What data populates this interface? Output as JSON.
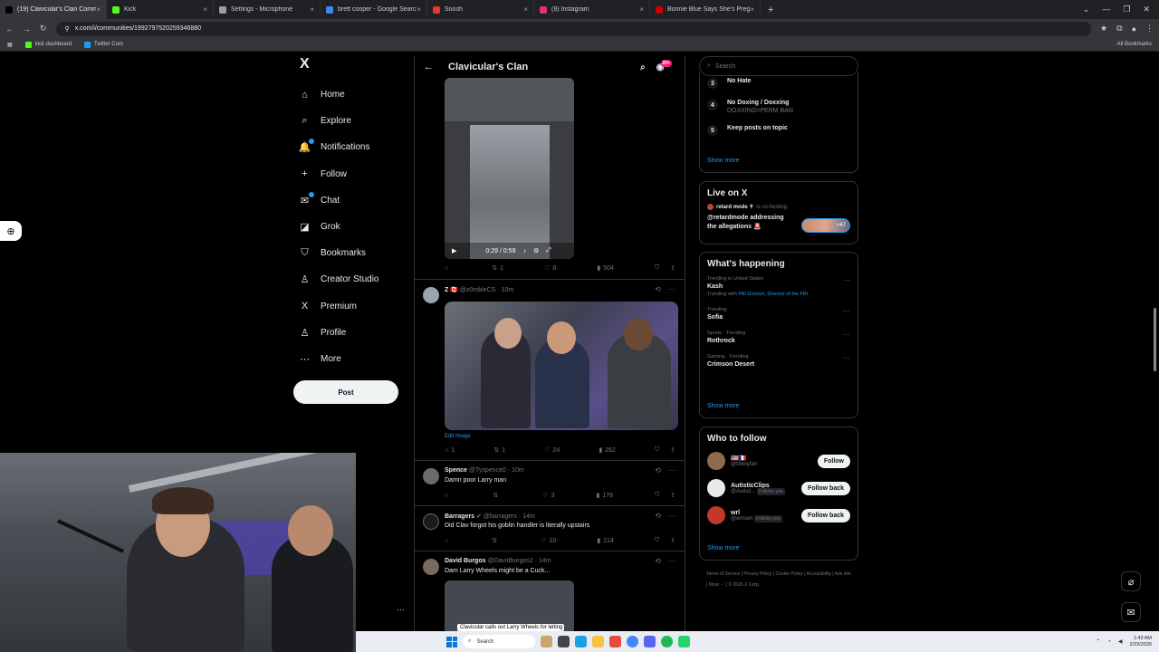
{
  "browser": {
    "tabs": [
      {
        "label": "(19) Clavicular's Clan Comm",
        "color": "#000000",
        "active": true
      },
      {
        "label": "Kick",
        "color": "#53fc18"
      },
      {
        "label": "Settings - Microphone",
        "color": "#9aa0a6"
      },
      {
        "label": "brett cooper - Google Search",
        "color": "#4285f4"
      },
      {
        "label": "Soosh",
        "color": "#e53935"
      },
      {
        "label": "(9) Instagram",
        "color": "#e1306c"
      },
      {
        "label": "Bonnie Blue Says She's Pregnan",
        "color": "#cc0000"
      }
    ],
    "url": "x.com/i/communities/1992797520259346880",
    "bookmarks": [
      {
        "label": "kick dashboard",
        "color": "#53fc18"
      },
      {
        "label": "Twitter Com",
        "color": "#1d9bf0"
      }
    ],
    "all_bookmarks": "All Bookmarks"
  },
  "nav": {
    "logo": "X",
    "items": [
      {
        "label": "Home",
        "icon": "⌂"
      },
      {
        "label": "Explore",
        "icon": "⌕"
      },
      {
        "label": "Notifications",
        "icon": "🔔"
      },
      {
        "label": "Follow",
        "icon": "+"
      },
      {
        "label": "Chat",
        "icon": "✉"
      },
      {
        "label": "Grok",
        "icon": "◪"
      },
      {
        "label": "Bookmarks",
        "icon": "⛉"
      },
      {
        "label": "Creator Studio",
        "icon": "♙"
      },
      {
        "label": "Premium",
        "icon": "X"
      },
      {
        "label": "Profile",
        "icon": "♙"
      },
      {
        "label": "More",
        "icon": "⋯"
      }
    ],
    "post_button": "Post"
  },
  "timeline": {
    "title": "Clavicular's Clan",
    "badge": "20+",
    "video": {
      "time": "0:29 / 0:59"
    },
    "video_actions": {
      "replies": "",
      "reposts": "1",
      "likes": "8",
      "views": "504"
    },
    "posts": [
      {
        "name": "Z",
        "flags": "🇨🇦",
        "handle": "@z0mbleCS",
        "time": "10m",
        "text": "",
        "edit_image": "Edit Image",
        "replies": "1",
        "reposts": "1",
        "likes": "24",
        "views": "262"
      },
      {
        "name": "Spence",
        "handle": "@Tyspence0",
        "time": "10m",
        "text": "Damn poor Larry man",
        "replies": "",
        "reposts": "",
        "likes": "3",
        "views": "176"
      },
      {
        "name": "Barragers",
        "handle": "@barragers",
        "time": "14m",
        "text": "Did Clav forgot his goblin handler is literally upstairs",
        "replies": "",
        "reposts": "",
        "likes": "10",
        "views": "214"
      },
      {
        "name": "David Burgos",
        "handle": "@Davidburgos2",
        "time": "14m",
        "text": "Dam Larry Wheels might be a Cuck...",
        "caption": "Clavicular calls out Larry Wheels for letting His wife have Guy Friends"
      }
    ]
  },
  "sidebar": {
    "search_placeholder": "Search",
    "rules": [
      {
        "num": "3",
        "title": "No Hate",
        "sub": ""
      },
      {
        "num": "4",
        "title": "No Doxing / Doxxing",
        "sub": "DOXXING=PERM BAN"
      },
      {
        "num": "5",
        "title": "Keep posts on topic",
        "sub": ""
      }
    ],
    "rules_show_more": "Show more",
    "live": {
      "title": "Live on X",
      "host": "retard mode ✝",
      "cohost_text": "is co-hosting",
      "description": "@retardmode addressing the allegations 🚨",
      "count": "+47"
    },
    "happening": {
      "title": "What's happening",
      "trends": [
        {
          "meta": "Trending in United States",
          "name": "Kash",
          "with_label": "Trending with",
          "with": "FBI Director, Director of the FBI"
        },
        {
          "meta": "Trending",
          "name": "Sofia"
        },
        {
          "meta": "Sports · Trending",
          "name": "Rothrock"
        },
        {
          "meta": "Gaming · Trending",
          "name": "Crimson Desert"
        }
      ],
      "show_more": "Show more"
    },
    "who_to_follow": {
      "title": "Who to follow",
      "accounts": [
        {
          "name": "🇺🇸🇫🇷",
          "handle": "@t3enyfan",
          "follows_you": "",
          "button": "Follow",
          "color": "#8c6b4f"
        },
        {
          "name": "AutisticClips",
          "handle": "@Autisti...",
          "follows_you": "Follows you",
          "button": "Follow back",
          "color": "#e7e9ea"
        },
        {
          "name": "wrl",
          "handle": "@wrlswrl",
          "follows_you": "Follows you",
          "button": "Follow back",
          "color": "#c0392b"
        }
      ],
      "show_more": "Show more"
    },
    "footer": [
      "Terms of Service",
      "Privacy Policy",
      "Cookie Policy",
      "Accessibility",
      "Ads info",
      "More ···",
      "© 2026 X Corp."
    ]
  },
  "taskbar": {
    "search": "Search",
    "time": "1:43 AM",
    "date": "2/23/2026"
  }
}
